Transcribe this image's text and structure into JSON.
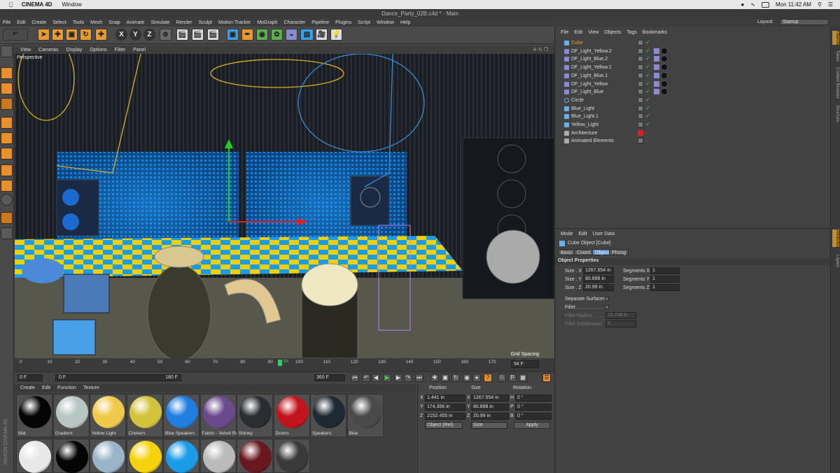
{
  "macbar": {
    "app": "CINEMA 4D",
    "menu_window": "Window",
    "clock": "Mon 11:42 AM"
  },
  "titlebar": {
    "title": "Dance_Party_02B.c4d * - Main"
  },
  "menubar": {
    "items": [
      "File",
      "Edit",
      "Create",
      "Select",
      "Tools",
      "Mesh",
      "Snap",
      "Animate",
      "Simulate",
      "Render",
      "Sculpt",
      "Motion Tracker",
      "MoGraph",
      "Character",
      "Pipeline",
      "Plugins",
      "Script",
      "Window",
      "Help"
    ],
    "layout_label": "Layout:",
    "layout_value": "Startup"
  },
  "toolbar": {
    "axis_x": "X",
    "axis_y": "Y",
    "axis_z": "Z"
  },
  "viewport": {
    "menu": [
      "View",
      "Cameras",
      "Display",
      "Options",
      "Filter",
      "Panel"
    ],
    "icons": "✛ ↻ ❐",
    "camera": "Perspective",
    "grid_spacing": "Grid Spacing"
  },
  "timeline": {
    "ticks": [
      "0",
      "10",
      "20",
      "30",
      "40",
      "50",
      "60",
      "70",
      "80",
      "90",
      "100",
      "110",
      "120",
      "130",
      "140",
      "150",
      "160",
      "170",
      "18"
    ],
    "current_frame": "94",
    "end_field": "94 F",
    "start_field": "0 F",
    "min_field": "0 F",
    "max_field": "180 F",
    "total_field": "360 F"
  },
  "materials": {
    "menu": [
      "Create",
      "Edit",
      "Function",
      "Texture"
    ],
    "items": [
      {
        "label": "Mat",
        "color": "#050505"
      },
      {
        "label": "Gradient",
        "color": "#b7c6c2"
      },
      {
        "label": "Yellow Light",
        "color": "#f1c94a"
      },
      {
        "label": "Chekers",
        "color": "#d2c33a"
      },
      {
        "label": "Blue Speakers",
        "color": "#1f7ee0"
      },
      {
        "label": "Fabric - Velvet Re",
        "color": "#6a4a8c"
      },
      {
        "label": "Shiney",
        "color": "#2a2e33"
      },
      {
        "label": "Drums",
        "color": "#c2141c"
      },
      {
        "label": "Speakers",
        "color": "#1e2a33"
      },
      {
        "label": "Blue",
        "color": "#4a4a4a"
      }
    ],
    "row2": [
      {
        "color": "#e8e8e8"
      },
      {
        "color": "#050505"
      },
      {
        "color": "#9ab4c8"
      },
      {
        "color": "#f5d20a"
      },
      {
        "color": "#1a9ce8"
      },
      {
        "color": "#bbbbbb"
      },
      {
        "color": "#6a1820"
      },
      {
        "color": "#3a3a3a"
      }
    ]
  },
  "coords": {
    "headers": [
      "Position",
      "Size",
      "Rotation"
    ],
    "rows": [
      {
        "axis": "X",
        "pos": "1.441 in",
        "size": "1267.554 in",
        "rot_axis": "H",
        "rot": "0 °"
      },
      {
        "axis": "Y",
        "pos": "174.356 in",
        "size": "80.898 in",
        "rot_axis": "P",
        "rot": "0 °"
      },
      {
        "axis": "Z",
        "pos": "2152.455 in",
        "size": "20.99 in",
        "rot_axis": "B",
        "rot": "0 °"
      }
    ],
    "mode_select": "Object (Rel)",
    "size_select": "Size",
    "apply": "Apply"
  },
  "objects": {
    "menu": [
      "File",
      "Edit",
      "View",
      "Objects",
      "Tags",
      "Bookmarks"
    ],
    "items": [
      {
        "name": "Cube",
        "selected": true
      },
      {
        "name": "DF_Light_Yellow.2"
      },
      {
        "name": "DF_Light_Blue.2"
      },
      {
        "name": "DF_Light_Yellow.1"
      },
      {
        "name": "DF_Light_Blue.1"
      },
      {
        "name": "DF_Light_Yellow"
      },
      {
        "name": "DF_Light_Blue"
      },
      {
        "name": "Circle"
      },
      {
        "name": "Blue_Light"
      },
      {
        "name": "Blue_Light.1"
      },
      {
        "name": "Yellow_Light"
      },
      {
        "name": "Architecture"
      },
      {
        "name": "Animated Elements"
      }
    ]
  },
  "attributes": {
    "menu": [
      "Mode",
      "Edit",
      "User Data"
    ],
    "object_title": "Cube Object [Cube]",
    "tabs": [
      "Basic",
      "Coord.",
      "Object",
      "Phong"
    ],
    "section": "Object Properties",
    "size_x_label": "Size . X",
    "size_x": "1267.554 in",
    "size_y_label": "Size . Y",
    "size_y": "80.898 in",
    "size_z_label": "Size . Z",
    "size_z": "20.99 in",
    "seg_x_label": "Segments X",
    "seg_x": "1",
    "seg_y_label": "Segments Y",
    "seg_y": "1",
    "seg_z_label": "Segments Z",
    "seg_z": "1",
    "separate_surfaces": "Separate Surfaces",
    "fillet": "Fillet . . . . . . . . . .",
    "fillet_radius_label": "Fillet Radius . . . . .",
    "fillet_radius": "15.748 in",
    "fillet_subdiv_label": "Fillet Subdivision",
    "fillet_subdiv": "5"
  },
  "right_tabs": [
    "Objects",
    "Takes",
    "Content Browser",
    "Structure",
    "Attributes",
    "Layers"
  ],
  "maxon": "MAXON CINEMA 4D"
}
